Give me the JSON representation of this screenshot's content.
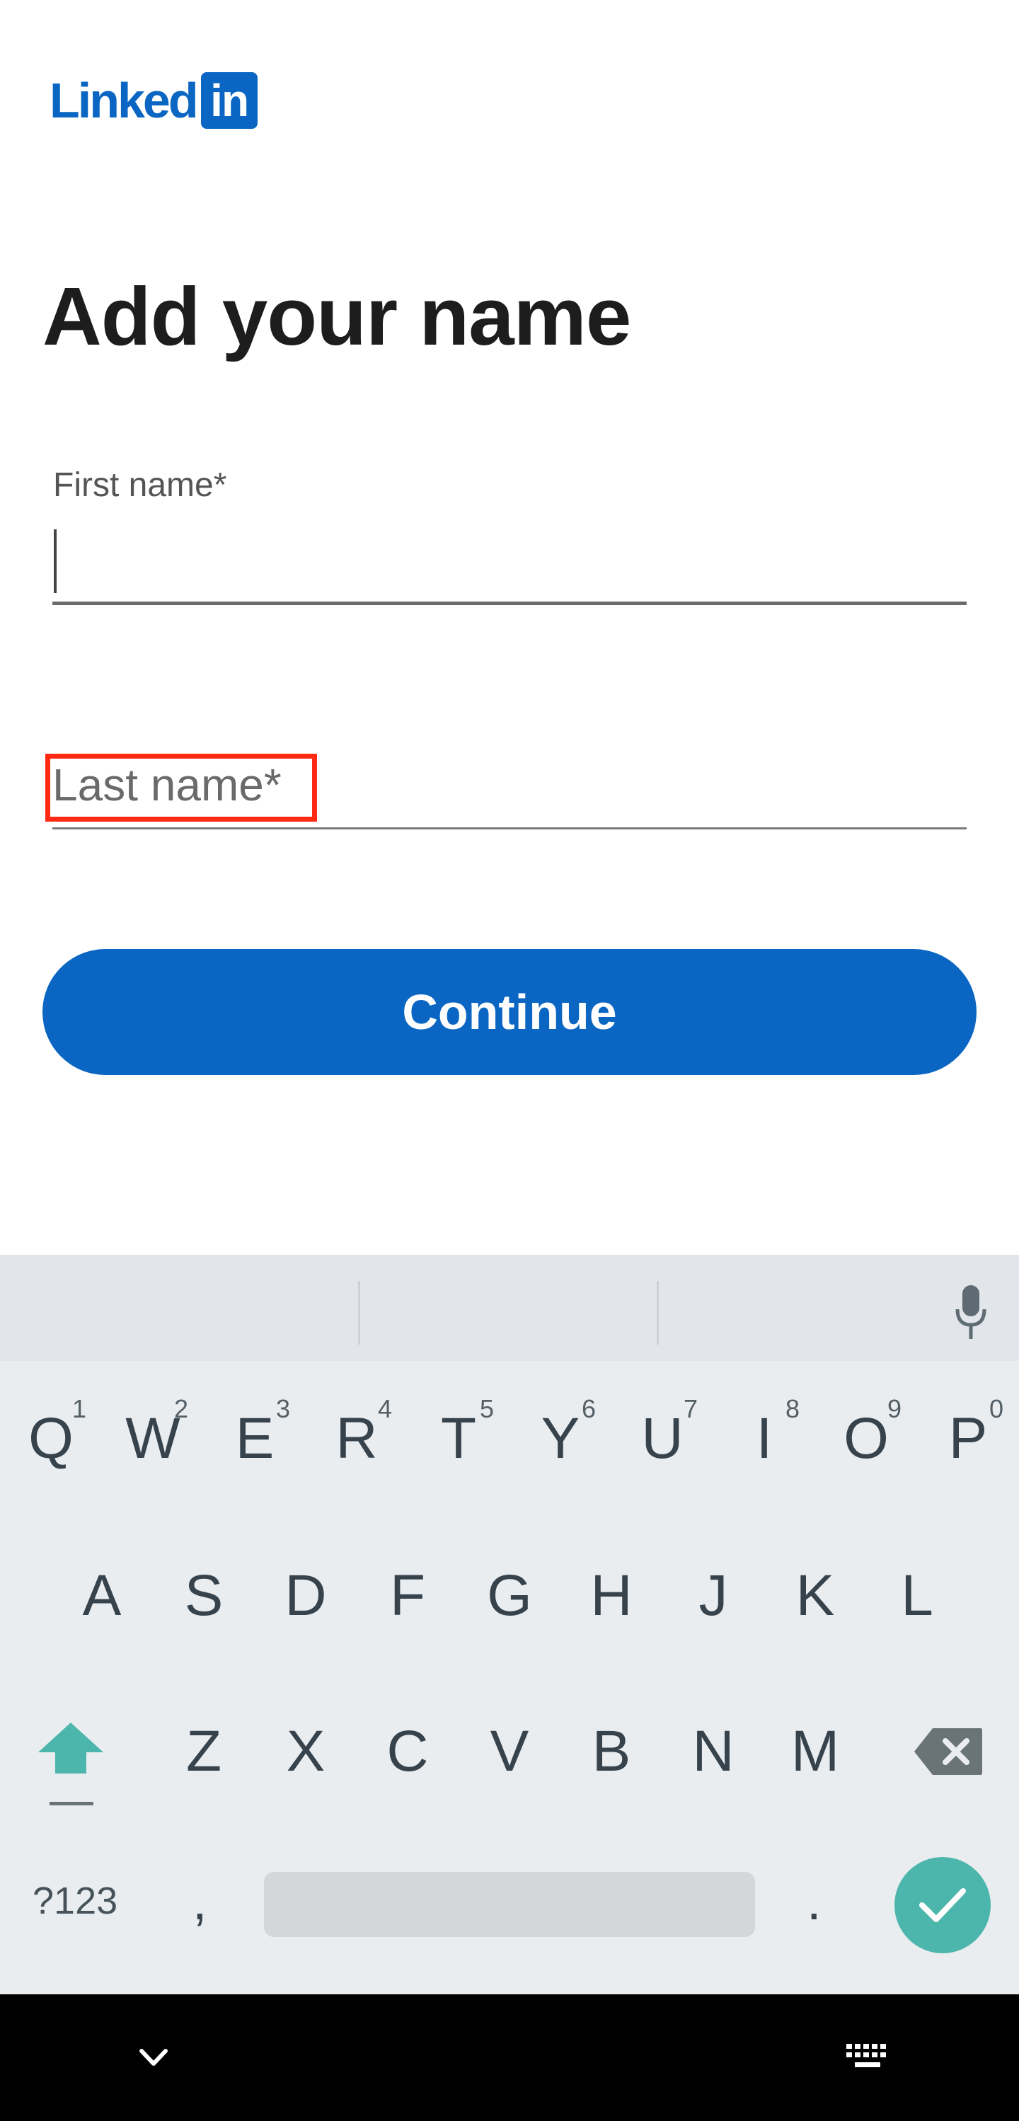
{
  "app": {
    "logo_text": "Linked",
    "logo_box": "in",
    "brand_color": "#0a66c2"
  },
  "page": {
    "title": "Add your name"
  },
  "form": {
    "first_name_label": "First name*",
    "last_name_label": "Last name*",
    "continue_label": "Continue",
    "highlight_color": "#ff2a12"
  },
  "keyboard": {
    "row1": [
      {
        "key": "Q",
        "num": "1"
      },
      {
        "key": "W",
        "num": "2"
      },
      {
        "key": "E",
        "num": "3"
      },
      {
        "key": "R",
        "num": "4"
      },
      {
        "key": "T",
        "num": "5"
      },
      {
        "key": "Y",
        "num": "6"
      },
      {
        "key": "U",
        "num": "7"
      },
      {
        "key": "I",
        "num": "8"
      },
      {
        "key": "O",
        "num": "9"
      },
      {
        "key": "P",
        "num": "0"
      }
    ],
    "row2": [
      "A",
      "S",
      "D",
      "F",
      "G",
      "H",
      "J",
      "K",
      "L"
    ],
    "row3": [
      "Z",
      "X",
      "C",
      "V",
      "B",
      "N",
      "M"
    ],
    "symbols_label": "?123",
    "comma": ",",
    "period": ".",
    "icons": [
      "mic-icon",
      "shift-icon",
      "backspace-icon",
      "enter-check-icon"
    ],
    "accent_color": "#4db6ac"
  },
  "navbar": {
    "icons": [
      "nav-hide-keyboard-icon",
      "nav-keyboard-switch-icon"
    ]
  }
}
